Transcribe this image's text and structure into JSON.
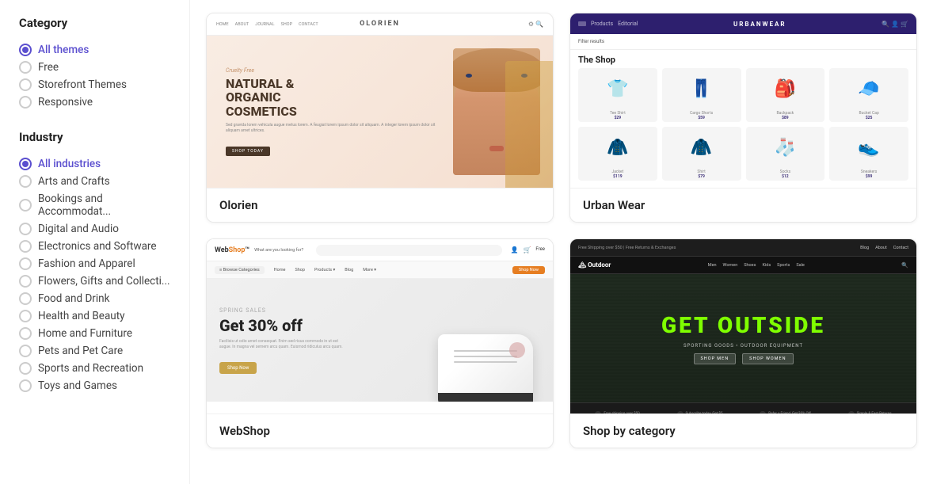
{
  "sidebar": {
    "category_title": "Category",
    "category_items": [
      {
        "id": "all-themes",
        "label": "All themes",
        "checked": true
      },
      {
        "id": "free",
        "label": "Free",
        "checked": false
      },
      {
        "id": "storefront-themes",
        "label": "Storefront Themes",
        "checked": false
      },
      {
        "id": "responsive",
        "label": "Responsive",
        "checked": false
      }
    ],
    "industry_title": "Industry",
    "industry_items": [
      {
        "id": "all-industries",
        "label": "All industries",
        "checked": true
      },
      {
        "id": "arts-crafts",
        "label": "Arts and Crafts",
        "checked": false
      },
      {
        "id": "bookings",
        "label": "Bookings and Accommodat...",
        "checked": false
      },
      {
        "id": "digital-audio",
        "label": "Digital and Audio",
        "checked": false
      },
      {
        "id": "electronics",
        "label": "Electronics and Software",
        "checked": false
      },
      {
        "id": "fashion",
        "label": "Fashion and Apparel",
        "checked": false
      },
      {
        "id": "flowers",
        "label": "Flowers, Gifts and Collecti...",
        "checked": false
      },
      {
        "id": "food-drink",
        "label": "Food and Drink",
        "checked": false
      },
      {
        "id": "health-beauty",
        "label": "Health and Beauty",
        "checked": false
      },
      {
        "id": "home-furniture",
        "label": "Home and Furniture",
        "checked": false
      },
      {
        "id": "pets",
        "label": "Pets and Pet Care",
        "checked": false
      },
      {
        "id": "sports",
        "label": "Sports and Recreation",
        "checked": false
      },
      {
        "id": "toys",
        "label": "Toys and Games",
        "checked": false
      }
    ]
  },
  "themes": [
    {
      "id": "olorien",
      "name": "Olorien",
      "hero_subtitle": "Cruelty Free",
      "hero_title": "NATURAL &\nORGANIC\nCOSMETICS",
      "hero_btn": "SHOP TODAY",
      "nav_logo": "OLORIEN"
    },
    {
      "id": "urban-wear",
      "name": "Urban Wear",
      "nav_logo": "URBANWEAR",
      "shop_title": "The Shop",
      "products": [
        "👕",
        "👖",
        "🎒",
        "🧢",
        "🧥",
        "🧦",
        "👟",
        ""
      ]
    },
    {
      "id": "webshop",
      "name": "WebShop",
      "hero_tag": "SPRING SALES",
      "hero_title": "Get 30% off",
      "hero_desc": "Facilisis ut odio amet consequat. Enim sed risus commodo in ut est augue. In magna vel semem arcu quam. Euismod ridiculus arcu quam.",
      "hero_btn": "Shop Now"
    },
    {
      "id": "get-outside",
      "name": "Shop by category",
      "hero_title": "GET OUTSIDE",
      "hero_sub": "Sporting goods • Outdoor Equipment",
      "btn1": "SHOP MEN",
      "btn2": "SHOP WOMEN"
    }
  ],
  "accent_color": "#5b4fcf",
  "orange_color": "#e67e22",
  "green_color": "#7fff00"
}
